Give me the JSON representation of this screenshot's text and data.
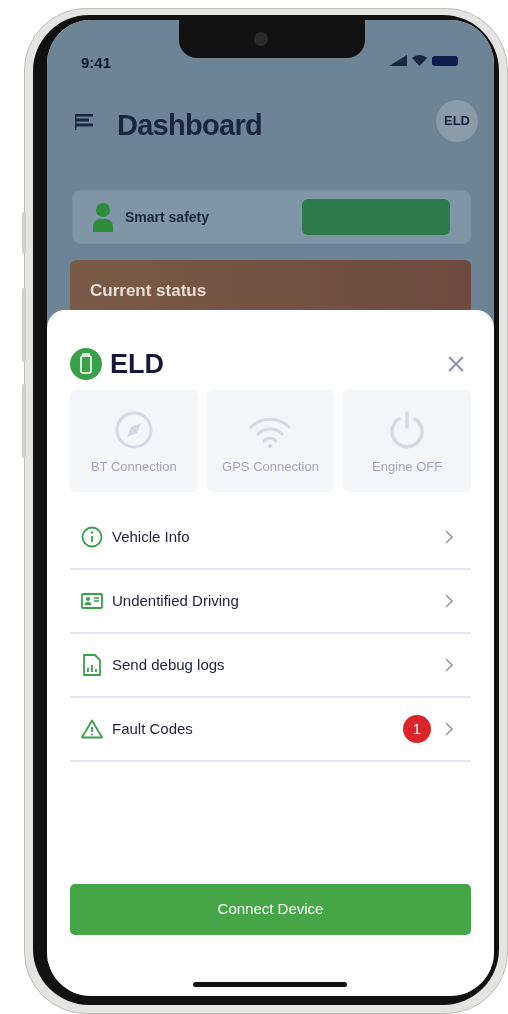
{
  "background": {
    "status_bar": {
      "time": "9:41"
    },
    "header": {
      "title": "Dashboard",
      "avatar": "ELD"
    },
    "safety_card": {
      "label": "Smart safety"
    },
    "status_card": {
      "title": "Current status"
    }
  },
  "sheet": {
    "title": "ELD",
    "tiles": [
      {
        "label": "BT Connection",
        "on": false
      },
      {
        "label": "GPS Connection",
        "on": false
      },
      {
        "label": "Engine OFF",
        "on": false
      }
    ],
    "items": [
      {
        "label": "Vehicle Info"
      },
      {
        "label": "Undentified Driving"
      },
      {
        "label": "Send debug logs"
      },
      {
        "label": "Fault Codes",
        "badge": "1"
      }
    ],
    "button": "Connect Device"
  }
}
